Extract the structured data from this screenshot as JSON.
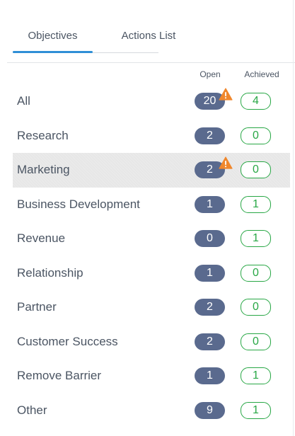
{
  "tabs": [
    {
      "label": "Objectives",
      "active": true
    },
    {
      "label": "Actions List",
      "active": false
    }
  ],
  "columns": {
    "open": "Open",
    "achieved": "Achieved"
  },
  "colors": {
    "active_tab": "#2f8fd6",
    "open_badge": "#5a6a8e",
    "achieved_badge": "#28a745",
    "warning": "#f0872c",
    "selected_row": "#e7e7e7"
  },
  "rows": [
    {
      "label": "All",
      "open": "20",
      "achieved": "4",
      "warning": true,
      "selected": false
    },
    {
      "label": "Research",
      "open": "2",
      "achieved": "0",
      "warning": false,
      "selected": false
    },
    {
      "label": "Marketing",
      "open": "2",
      "achieved": "0",
      "warning": true,
      "selected": true
    },
    {
      "label": "Business Development",
      "open": "1",
      "achieved": "1",
      "warning": false,
      "selected": false
    },
    {
      "label": "Revenue",
      "open": "0",
      "achieved": "1",
      "warning": false,
      "selected": false
    },
    {
      "label": "Relationship",
      "open": "1",
      "achieved": "0",
      "warning": false,
      "selected": false
    },
    {
      "label": "Partner",
      "open": "2",
      "achieved": "0",
      "warning": false,
      "selected": false
    },
    {
      "label": "Customer Success",
      "open": "2",
      "achieved": "0",
      "warning": false,
      "selected": false
    },
    {
      "label": "Remove Barrier",
      "open": "1",
      "achieved": "1",
      "warning": false,
      "selected": false
    },
    {
      "label": "Other",
      "open": "9",
      "achieved": "1",
      "warning": false,
      "selected": false
    }
  ]
}
